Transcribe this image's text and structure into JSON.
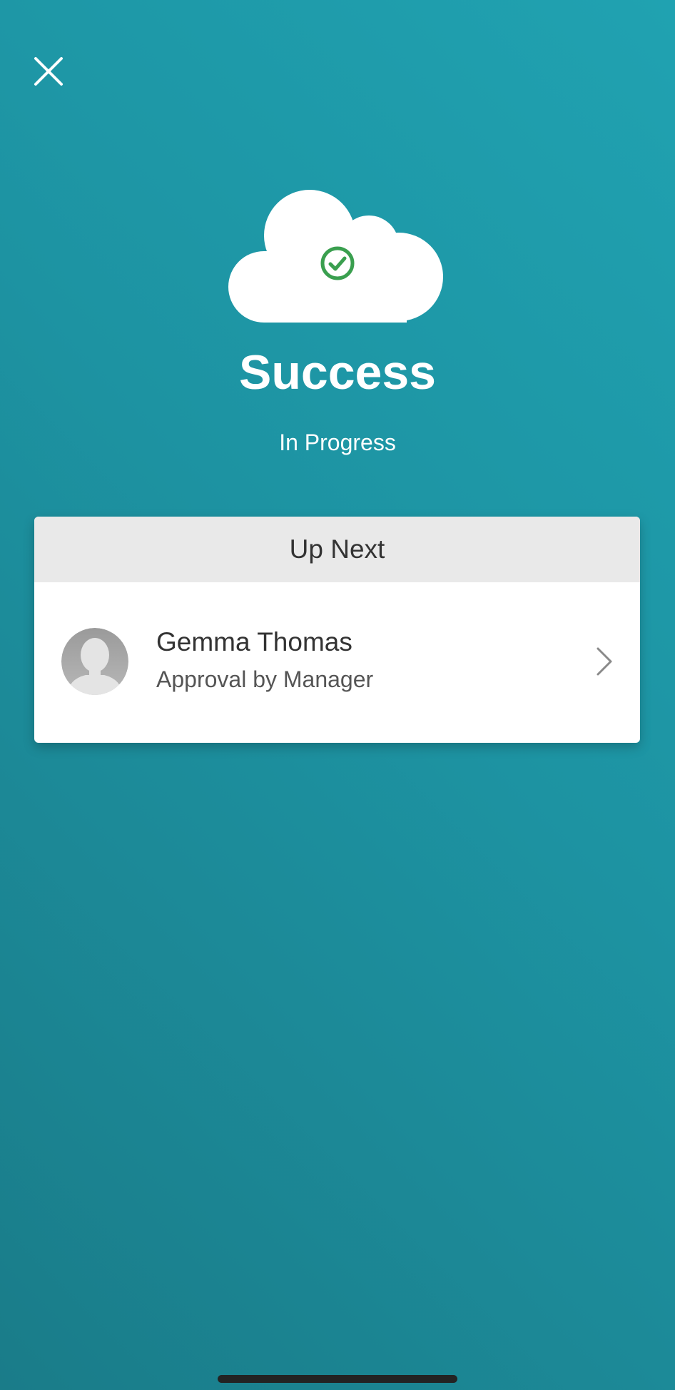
{
  "header": {
    "close_icon": "close-icon"
  },
  "status": {
    "icon": "cloud-check-icon",
    "title": "Success",
    "subtitle": "In Progress"
  },
  "up_next": {
    "header": "Up Next",
    "items": [
      {
        "name": "Gemma Thomas",
        "role": "Approval by Manager",
        "avatar_icon": "user-placeholder-icon",
        "chevron_icon": "chevron-right-icon"
      }
    ]
  },
  "colors": {
    "background_start": "#1a7c89",
    "background_end": "#20a2b1",
    "check_green": "#3a9f4f",
    "card_header_bg": "#e9e9e9"
  }
}
